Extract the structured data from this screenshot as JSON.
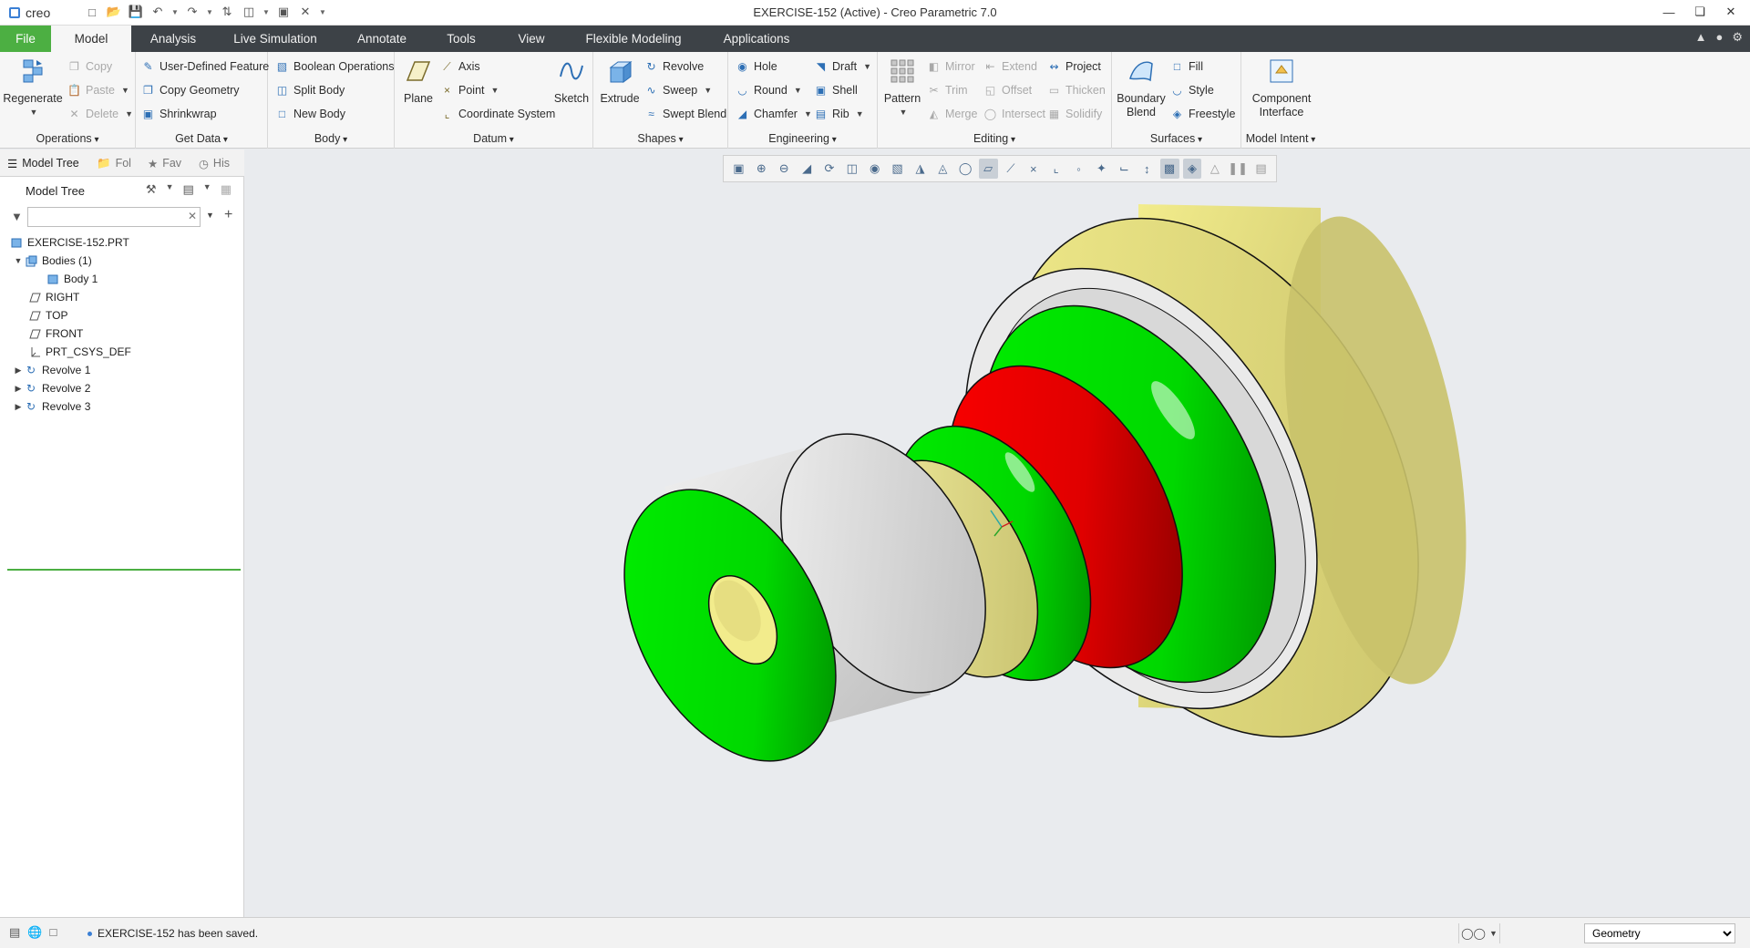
{
  "app": {
    "logo_text": "creo",
    "window_title": "EXERCISE-152 (Active) - Creo Parametric 7.0"
  },
  "ribbon_tabs": [
    "File",
    "Model",
    "Analysis",
    "Live Simulation",
    "Annotate",
    "Tools",
    "View",
    "Flexible Modeling",
    "Applications"
  ],
  "groups": {
    "operations": {
      "label": "Operations",
      "regenerate": "Regenerate",
      "copy": "Copy",
      "paste": "Paste",
      "delete": "Delete"
    },
    "get_data": {
      "label": "Get Data",
      "udf": "User-Defined Feature",
      "copy_geometry": "Copy Geometry",
      "shrinkwrap": "Shrinkwrap"
    },
    "body": {
      "label": "Body",
      "boolean": "Boolean Operations",
      "split": "Split Body",
      "new": "New Body"
    },
    "datum": {
      "label": "Datum",
      "plane": "Plane",
      "axis": "Axis",
      "point": "Point",
      "csys": "Coordinate System",
      "sketch": "Sketch"
    },
    "shapes": {
      "label": "Shapes",
      "extrude": "Extrude",
      "revolve": "Revolve",
      "sweep": "Sweep",
      "swept_blend": "Swept Blend"
    },
    "engineering": {
      "label": "Engineering",
      "hole": "Hole",
      "round": "Round",
      "chamfer": "Chamfer",
      "draft": "Draft",
      "shell": "Shell",
      "rib": "Rib"
    },
    "editing": {
      "label": "Editing",
      "pattern": "Pattern",
      "mirror": "Mirror",
      "trim": "Trim",
      "merge": "Merge",
      "extend": "Extend",
      "offset": "Offset",
      "intersect": "Intersect",
      "project": "Project",
      "thicken": "Thicken",
      "solidify": "Solidify"
    },
    "surfaces": {
      "label": "Surfaces",
      "boundary_blend_1": "Boundary",
      "boundary_blend_2": "Blend",
      "fill": "Fill",
      "style": "Style",
      "freestyle": "Freestyle"
    },
    "model_intent": {
      "label": "Model Intent",
      "component_interface_1": "Component",
      "component_interface_2": "Interface"
    }
  },
  "navigator": {
    "tabs": [
      "Model Tree",
      "Fol",
      "Fav",
      "His"
    ],
    "tree_title": "Model Tree",
    "filter_placeholder": "",
    "items": [
      {
        "label": "EXERCISE-152.PRT",
        "icon": "part-icon"
      },
      {
        "label": "Bodies (1)",
        "icon": "bodies-icon"
      },
      {
        "label": "Body 1",
        "icon": "body-icon"
      },
      {
        "label": "RIGHT",
        "icon": "datum-plane-icon"
      },
      {
        "label": "TOP",
        "icon": "datum-plane-icon"
      },
      {
        "label": "FRONT",
        "icon": "datum-plane-icon"
      },
      {
        "label": "PRT_CSYS_DEF",
        "icon": "csys-icon"
      },
      {
        "label": "Revolve 1",
        "icon": "revolve-icon"
      },
      {
        "label": "Revolve 2",
        "icon": "revolve-icon"
      },
      {
        "label": "Revolve 3",
        "icon": "revolve-icon"
      }
    ]
  },
  "colors": {
    "file_tab": "#4caf42",
    "tab_bar": "#3d4247",
    "face_green": "#00ee00",
    "face_red": "#ee0000",
    "face_yellow": "#f2ec8c",
    "face_white": "#e6e6e6"
  },
  "status": {
    "message": "EXERCISE-152 has been saved.",
    "selection_filter": "Geometry"
  }
}
